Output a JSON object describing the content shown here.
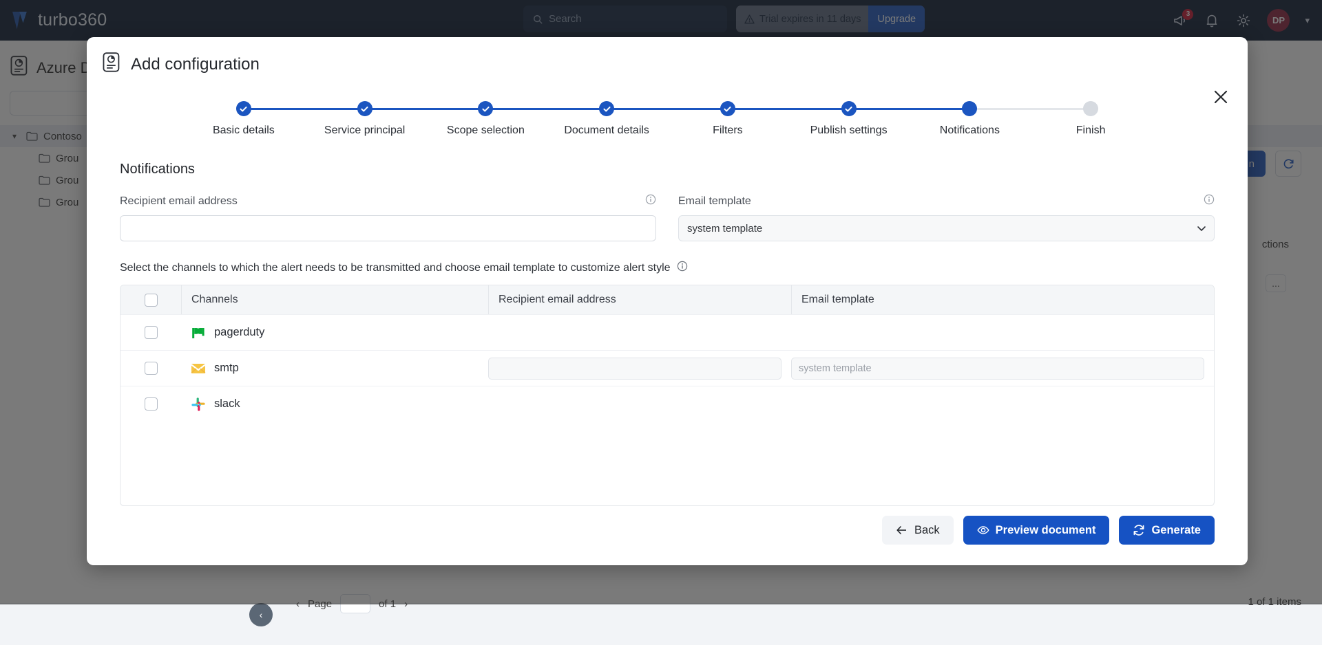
{
  "topnav": {
    "brand": "turbo360",
    "search_placeholder": "Search",
    "trial_text": "Trial expires in 11 days",
    "upgrade_label": "Upgrade",
    "notification_badge": "3",
    "avatar_initials": "DP"
  },
  "background_page": {
    "title": "Azure Do",
    "tree": [
      {
        "label": "Contoso",
        "level": 0,
        "selected": true,
        "expanded": true
      },
      {
        "label": "Grou",
        "level": 1,
        "selected": false,
        "expanded": false
      },
      {
        "label": "Grou",
        "level": 1,
        "selected": false,
        "expanded": false
      },
      {
        "label": "Grou",
        "level": 1,
        "selected": false,
        "expanded": false
      }
    ],
    "action_button": "n",
    "actions_header": "ctions",
    "dots_label": "...",
    "pager_label": "Page",
    "pager_of": "of 1",
    "items_count": "1 of 1 items"
  },
  "modal": {
    "title": "Add configuration",
    "title_icon": "document-chart-icon",
    "close_icon": "close-icon",
    "steps": [
      {
        "label": "Basic details",
        "state": "done"
      },
      {
        "label": "Service principal",
        "state": "done"
      },
      {
        "label": "Scope selection",
        "state": "done"
      },
      {
        "label": "Document details",
        "state": "done"
      },
      {
        "label": "Filters",
        "state": "done"
      },
      {
        "label": "Publish settings",
        "state": "done"
      },
      {
        "label": "Notifications",
        "state": "active"
      },
      {
        "label": "Finish",
        "state": "todo"
      }
    ],
    "section_title": "Notifications",
    "recipient_email": {
      "label": "Recipient email address",
      "value": "",
      "placeholder": ""
    },
    "email_template": {
      "label": "Email template",
      "value": "system template"
    },
    "helper_text": "Select the channels to which the alert needs to be transmitted and choose email template to customize alert style",
    "table": {
      "columns": [
        "Channels",
        "Recipient email address",
        "Email template"
      ],
      "rows": [
        {
          "channel": "pagerduty",
          "icon": "pagerduty-icon",
          "checked": false,
          "has_inputs": false,
          "recipient_value": "",
          "recipient_placeholder": "",
          "template_value": "",
          "template_placeholder": ""
        },
        {
          "channel": "smtp",
          "icon": "smtp-envelope-icon",
          "checked": false,
          "has_inputs": true,
          "recipient_value": "",
          "recipient_placeholder": "",
          "template_value": "",
          "template_placeholder": "system template"
        },
        {
          "channel": "slack",
          "icon": "slack-icon",
          "checked": false,
          "has_inputs": false,
          "recipient_value": "",
          "recipient_placeholder": "",
          "template_value": "",
          "template_placeholder": ""
        }
      ]
    },
    "footer": {
      "back_label": "Back",
      "preview_label": "Preview document",
      "generate_label": "Generate"
    }
  },
  "colors": {
    "navy": "#0a1931",
    "primary_blue": "#1652c3",
    "step_blue": "#1b55c0",
    "step_gray": "#d6dae0",
    "badge_red": "#c8102e",
    "avatar_maroon": "#8c1d3c",
    "pagerduty_green": "#06ac38",
    "smtp_yellow": "#f6b93b"
  }
}
